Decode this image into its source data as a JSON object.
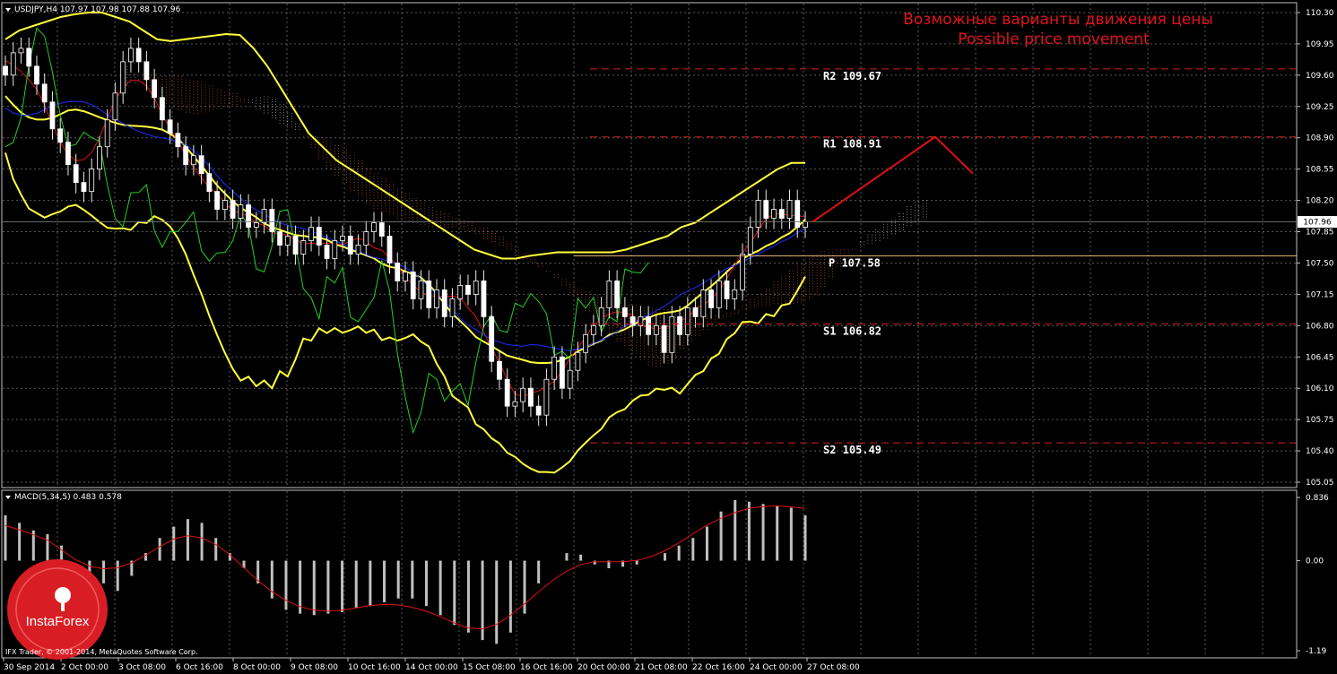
{
  "header": {
    "symbol_label": "USDJPY,H4  107.97 107.98 107.88 107.96",
    "macd_label": "MACD(5,34,5) 0.483 0.578"
  },
  "annotation": {
    "line1": "Возможные варианты движения цены",
    "line2": "Possible price movement",
    "color": "#e0141e"
  },
  "footer": {
    "copyright": "IFX Trader, © 2001-2014, MetaQuotes Software Corp."
  },
  "logo": {
    "name": "InstaForex",
    "color": "#d81e24"
  },
  "colors": {
    "background": "#000000",
    "grid": "#5a5a5a",
    "bull_candle": "#ffffff",
    "bear_candle": "#ffffff",
    "bollinger": "#ffff3c",
    "tenkan": "#e01010",
    "kijun": "#1a2cff",
    "chikou": "#22d022",
    "kumo": "#d0d0d0",
    "kumo_alt": "#e06a3c",
    "macd_hist": "#c0c0c0",
    "macd_signal": "#e01010",
    "pivot": "#e0b070",
    "resistance": "#d02020",
    "support": "#d02020",
    "projection": "#e01010"
  },
  "chart_data": [
    {
      "type": "candlestick",
      "symbol": "USDJPY",
      "timeframe": "H4",
      "ylim": [
        105.05,
        110.3
      ],
      "y_ticks": [
        110.3,
        109.95,
        109.6,
        109.25,
        108.9,
        108.55,
        108.2,
        107.85,
        107.5,
        107.15,
        106.8,
        106.45,
        106.1,
        105.75,
        105.4,
        105.05
      ],
      "x_tick_labels": [
        "30 Sep 2014",
        "2 Oct 00:00",
        "3 Oct 08:00",
        "6 Oct 16:00",
        "8 Oct 00:00",
        "9 Oct 08:00",
        "10 Oct 16:00",
        "14 Oct 00:00",
        "15 Oct 08:00",
        "16 Oct 16:00",
        "20 Oct 00:00",
        "21 Oct 08:00",
        "22 Oct 16:00",
        "24 Oct 00:00",
        "27 Oct 08:00"
      ],
      "current_price": 107.96,
      "candle_closes": [
        109.6,
        109.85,
        109.9,
        109.7,
        109.5,
        109.3,
        109.0,
        108.85,
        108.6,
        108.4,
        108.3,
        108.55,
        108.8,
        109.1,
        109.4,
        109.75,
        109.9,
        109.75,
        109.55,
        109.35,
        109.1,
        108.95,
        108.8,
        108.6,
        108.7,
        108.5,
        108.3,
        108.1,
        108.2,
        108.0,
        108.15,
        107.9,
        107.95,
        108.1,
        107.85,
        107.7,
        107.8,
        107.6,
        107.75,
        107.9,
        107.7,
        107.55,
        107.75,
        107.8,
        107.6,
        107.7,
        107.85,
        107.95,
        107.8,
        107.5,
        107.3,
        107.4,
        107.1,
        107.3,
        107.0,
        107.2,
        106.9,
        107.1,
        107.25,
        107.15,
        107.3,
        106.9,
        106.4,
        106.2,
        105.9,
        105.95,
        106.1,
        105.9,
        105.8,
        106.2,
        106.45,
        106.1,
        106.3,
        106.5,
        106.7,
        106.8,
        107.0,
        107.3,
        107.0,
        106.9,
        106.8,
        106.9,
        106.7,
        106.8,
        106.5,
        106.9,
        106.7,
        107.0,
        106.9,
        107.2,
        107.0,
        107.3,
        107.1,
        107.2,
        107.6,
        107.9,
        108.2,
        108.0,
        108.1,
        108.0,
        108.2,
        107.9,
        107.96
      ],
      "bollinger_upper": [
        110.0,
        110.1,
        110.15,
        110.2,
        110.25,
        110.28,
        110.3,
        110.3,
        110.25,
        110.2,
        110.1,
        110.0,
        109.98,
        110.0,
        110.02,
        110.04,
        110.06,
        110.05,
        109.9,
        109.7,
        109.45,
        109.2,
        108.95,
        108.8,
        108.65,
        108.55,
        108.45,
        108.35,
        108.25,
        108.15,
        108.05,
        107.95,
        107.85,
        107.75,
        107.65,
        107.6,
        107.55,
        107.55,
        107.58,
        107.6,
        107.62,
        107.62,
        107.62,
        107.62,
        107.62,
        107.65,
        107.7,
        107.75,
        107.8,
        107.9,
        107.95,
        108.05,
        108.15,
        108.25,
        108.35,
        108.45,
        108.55,
        108.62,
        108.62
      ],
      "macd_ylim": [
        -1.19,
        0.836
      ],
      "macd_ticks": [
        0.836,
        0.0,
        -1.19
      ],
      "macd_hist": [
        0.6,
        0.5,
        0.4,
        0.35,
        0.2,
        0.0,
        -0.15,
        -0.3,
        -0.4,
        -0.2,
        0.1,
        0.3,
        0.45,
        0.55,
        0.5,
        0.3,
        0.1,
        -0.1,
        -0.3,
        -0.5,
        -0.65,
        -0.7,
        -0.72,
        -0.7,
        -0.68,
        -0.62,
        -0.6,
        -0.55,
        -0.5,
        -0.5,
        -0.6,
        -0.72,
        -0.85,
        -0.95,
        -1.05,
        -1.1,
        -0.95,
        -0.7,
        -0.3,
        0.0,
        0.1,
        0.08,
        -0.05,
        -0.1,
        -0.08,
        -0.05,
        0.0,
        0.1,
        0.2,
        0.3,
        0.45,
        0.65,
        0.8,
        0.78,
        0.75,
        0.72,
        0.7,
        0.6
      ],
      "pivot_levels": [
        {
          "name": "R2",
          "label": "R2  109.67",
          "value": 109.67
        },
        {
          "name": "R1",
          "label": "R1  108.91",
          "value": 108.91
        },
        {
          "name": "P",
          "label": "P  107.58",
          "value": 107.58
        },
        {
          "name": "S1",
          "label": "S1  106.82",
          "value": 106.82
        },
        {
          "name": "S2",
          "label": "S2  105.49",
          "value": 105.49
        }
      ],
      "projection": [
        {
          "x_label": "27 Oct 08:00",
          "price": 107.96
        },
        {
          "x_label": "",
          "price": 108.91
        },
        {
          "x_label": "",
          "price": 108.5
        }
      ]
    }
  ]
}
